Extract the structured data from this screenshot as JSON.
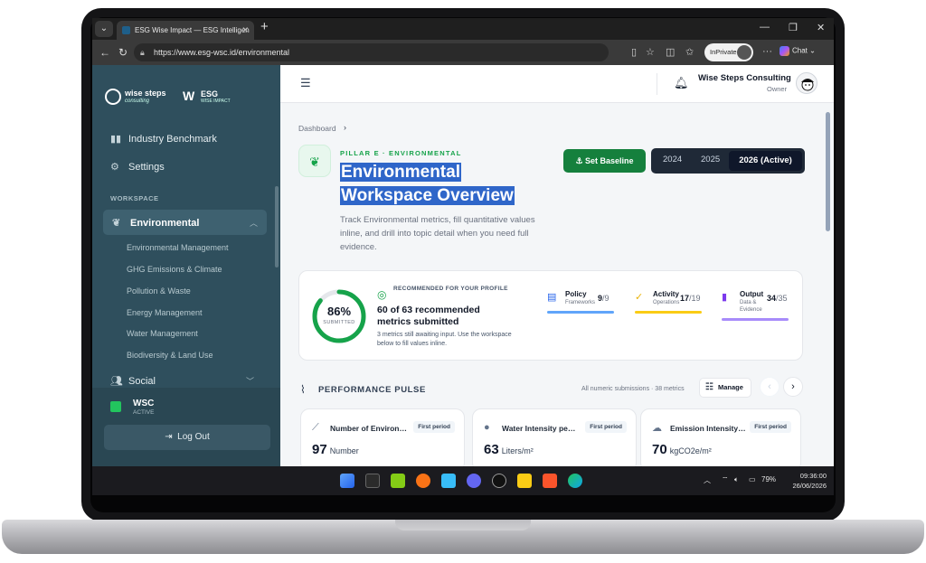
{
  "browser": {
    "tab_title": "ESG Wise Impact — ESG Intelligen",
    "url": "https://www.esg-wsc.id/environmental",
    "inprivate_label": "InPrivate",
    "chat_label": "Chat"
  },
  "sidebar": {
    "brand_one": "wise steps",
    "brand_one_sub": "consulting",
    "brand_two": "ESG",
    "brand_two_sub": "WISE IMPACT",
    "items": [
      {
        "label": "Industry Benchmark",
        "icon": "bar-chart-icon"
      },
      {
        "label": "Settings",
        "icon": "gear-icon"
      }
    ],
    "section_label": "WORKSPACE",
    "active_item": "Environmental",
    "sub_items": [
      "Environmental Management",
      "GHG Emissions & Climate",
      "Pollution & Waste",
      "Energy Management",
      "Water Management",
      "Biodiversity & Land Use"
    ],
    "next_group": "Social",
    "org_name": "WSC",
    "org_status": "ACTIVE",
    "logout_label": "Log Out"
  },
  "header": {
    "user_name": "Wise Steps Consulting",
    "user_role": "Owner"
  },
  "page": {
    "breadcrumb_root": "Dashboard",
    "pillar_label": "PILLAR E · ENVIRONMENTAL",
    "title_line1": "Environmental",
    "title_line2": "Workspace Overview",
    "description": "Track Environmental metrics, fill quantitative values inline, and drill into topic detail when you need full evidence.",
    "set_baseline_label": "Set Baseline",
    "years": [
      "2024",
      "2025"
    ],
    "active_year": "2026 (Active)"
  },
  "recommended": {
    "percent": "86%",
    "percent_value": 86,
    "percent_label": "SUBMITTED",
    "label": "RECOMMENDED FOR YOUR PROFILE",
    "headline": "60 of 63 recommended metrics submitted",
    "note": "3 metrics still awaiting input. Use the workspace below to fill values inline.",
    "stats": [
      {
        "name": "Policy",
        "sub": "Frameworks",
        "value": "9",
        "total": "/9",
        "color": "#60a5fa",
        "icon": "document-icon"
      },
      {
        "name": "Activity",
        "sub": "Operations",
        "value": "17",
        "total": "/19",
        "color": "#facc15",
        "icon": "check-circle-icon"
      },
      {
        "name": "Output",
        "sub": "Data & Evidence",
        "value": "34",
        "total": "/35",
        "color": "#a78bfa",
        "icon": "chart-icon"
      }
    ]
  },
  "pulse": {
    "title": "PERFORMANCE PULSE",
    "note": "All numeric submissions · 38 metrics",
    "manage_label": "Manage",
    "metrics": [
      {
        "name": "Number of Environ…",
        "badge": "First period",
        "value": "97",
        "unit": "Number",
        "icon": "trend-icon"
      },
      {
        "name": "Water Intensity pe…",
        "badge": "First period",
        "value": "63",
        "unit": "Liters/m²",
        "icon": "droplet-icon"
      },
      {
        "name": "Emission Intensity…",
        "badge": "First period",
        "value": "70",
        "unit": "kgCO2e/m²",
        "icon": "cloud-icon"
      }
    ]
  },
  "taskbar": {
    "battery": "79%",
    "time": "09:36:00",
    "date": "26/06/2026"
  }
}
